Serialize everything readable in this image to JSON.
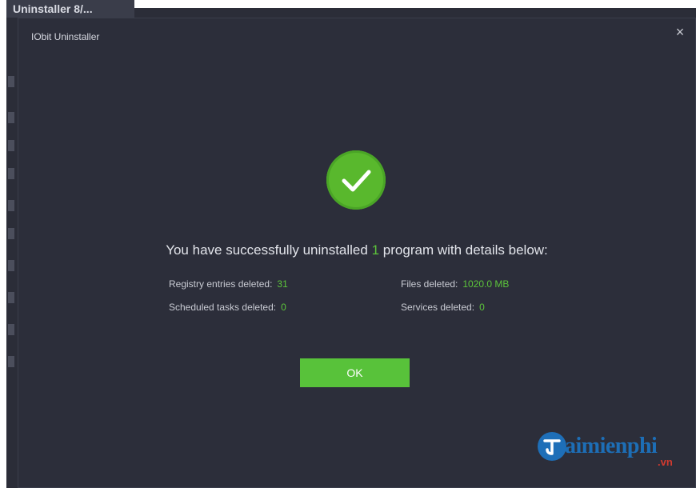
{
  "background_app": {
    "title": "Uninstaller 8/..."
  },
  "dialog": {
    "title": "IObit Uninstaller",
    "close_icon": "×"
  },
  "result": {
    "headline_prefix": "You have successfully uninstalled",
    "program_count": "1",
    "headline_suffix": "program with details below:",
    "registry_label": "Registry entries deleted:",
    "registry_value": "31",
    "files_label": "Files deleted:",
    "files_value": "1020.0 MB",
    "tasks_label": "Scheduled tasks deleted:",
    "tasks_value": "0",
    "services_label": "Services deleted:",
    "services_value": "0"
  },
  "buttons": {
    "ok_label": "OK"
  },
  "watermark": {
    "text": "aimienphi",
    "suffix": ".vn"
  },
  "colors": {
    "accent_green": "#5cc43a",
    "dialog_bg": "#2c2e3a"
  }
}
